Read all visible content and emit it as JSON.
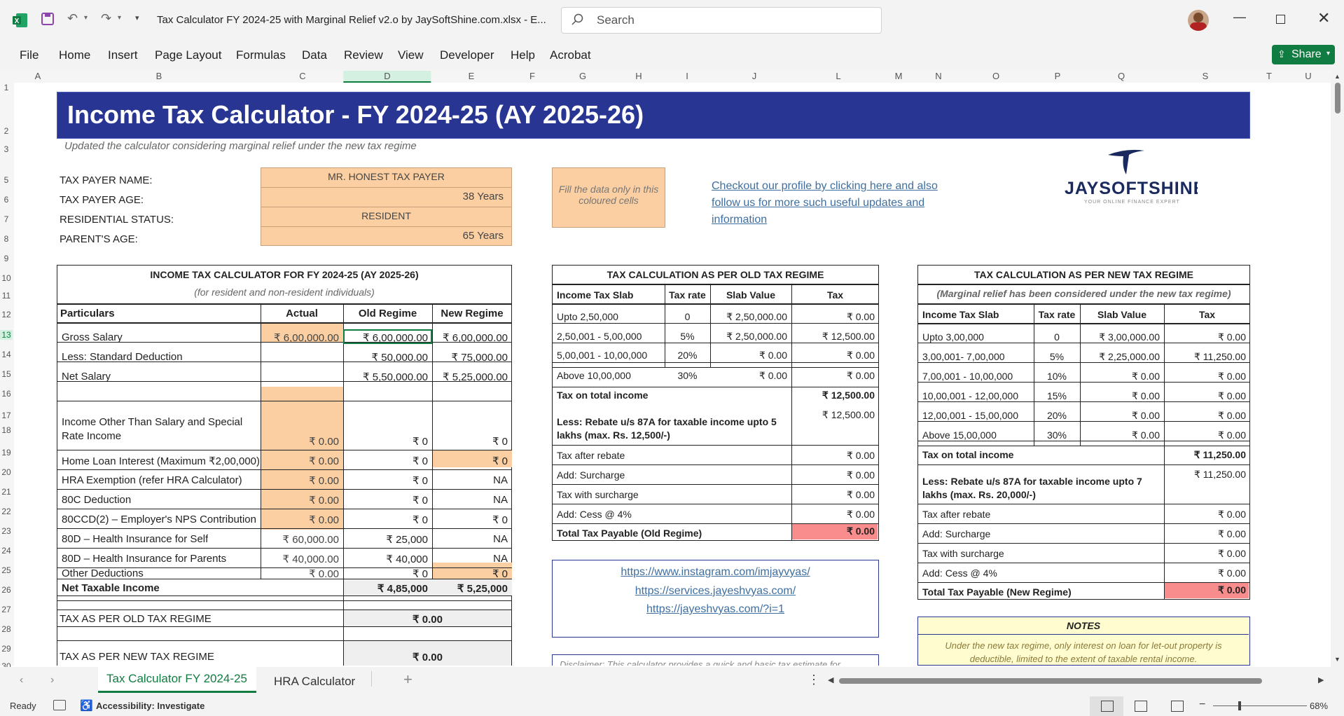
{
  "app": {
    "file_title": "Tax Calculator FY 2024-25 with Marginal Relief v2.o by JaySoftShine.com.xlsx  -  E...",
    "search_placeholder": "Search",
    "share_label": "Share"
  },
  "menu": [
    "File",
    "Home",
    "Insert",
    "Page Layout",
    "Formulas",
    "Data",
    "Review",
    "View",
    "Developer",
    "Help",
    "Acrobat"
  ],
  "columns": [
    "A",
    "B",
    "C",
    "D",
    "E",
    "F",
    "G",
    "H",
    "I",
    "J",
    "L",
    "M",
    "N",
    "O",
    "P",
    "Q",
    "S",
    "T",
    "U"
  ],
  "rows": [
    "1",
    "2",
    "3",
    "5",
    "6",
    "7",
    "8",
    "9",
    "10",
    "11",
    "12",
    "13",
    "14",
    "15",
    "16",
    "17",
    "18",
    "19",
    "20",
    "21",
    "22",
    "23",
    "24",
    "25",
    "26",
    "27",
    "28",
    "29",
    "30"
  ],
  "banner": {
    "title": "Income Tax Calculator - FY 2024-25 (AY 2025-26)",
    "subtitle": "Updated the calculator considering marginal relief under the new tax regime"
  },
  "taxpayer": {
    "name_label": "TAX PAYER NAME:",
    "name_value": "MR. HONEST TAX PAYER",
    "age_label": "TAX PAYER AGE:",
    "age_value": "38 Years",
    "status_label": "RESIDENTIAL STATUS:",
    "status_value": "RESIDENT",
    "parent_label": "PARENT'S AGE:",
    "parent_value": "65 Years"
  },
  "fill_note": "Fill the data only in this coloured cells",
  "profile_link": "Checkout our profile by clicking here and also follow us for more such useful updates and information",
  "logo": {
    "name": "JAYSOFTSHINE",
    "tagline": "YOUR ONLINE FINANCE EXPERT"
  },
  "main_table": {
    "title": "INCOME TAX CALCULATOR FOR FY 2024-25 (AY 2025-26)",
    "subtitle": "(for resident and non-resident individuals)",
    "headers": [
      "Particulars",
      "Actual",
      "Old Regime",
      "New Regime"
    ],
    "rows": [
      [
        "Gross Salary",
        "₹ 6,00,000.00",
        "₹ 6,00,000.00",
        "₹ 6,00,000.00"
      ],
      [
        "Less: Standard Deduction",
        "",
        "₹ 50,000.00",
        "₹ 75,000.00"
      ],
      [
        "Net Salary",
        "",
        "₹ 5,50,000.00",
        "₹ 5,25,000.00"
      ],
      [
        "",
        "",
        "",
        ""
      ],
      [
        "Income Other Than Salary and Special Rate Income",
        "₹ 0.00",
        "₹ 0",
        "₹ 0"
      ],
      [
        "Home Loan Interest (Maximum ₹2,00,000)",
        "₹ 0.00",
        "₹ 0",
        "₹ 0"
      ],
      [
        "HRA Exemption (refer HRA Calculator)",
        "₹ 0.00",
        "₹ 0",
        "NA"
      ],
      [
        "80C Deduction",
        "₹ 0.00",
        "₹ 0",
        "NA"
      ],
      [
        "80CCD(2) – Employer's NPS Contribution",
        "₹ 0.00",
        "₹ 0",
        "₹ 0"
      ],
      [
        "80D – Health Insurance for Self",
        "₹ 60,000.00",
        "₹ 25,000",
        "NA"
      ],
      [
        "80D – Health Insurance for Parents",
        "₹ 40,000.00",
        "₹ 40,000",
        "NA"
      ],
      [
        "Other Deductions",
        "₹ 0.00",
        "₹ 0",
        "₹ 0"
      ]
    ],
    "net_taxable_label": "Net Taxable Income",
    "net_taxable_old": "₹ 4,85,000",
    "net_taxable_new": "₹ 5,25,000",
    "old_label": "TAX AS PER OLD TAX REGIME",
    "old_value": "₹ 0.00",
    "new_label": "TAX AS PER NEW TAX REGIME",
    "new_value": "₹ 0.00"
  },
  "old_regime": {
    "title": "TAX CALCULATION AS PER OLD TAX REGIME",
    "headers": [
      "Income Tax Slab",
      "Tax rate",
      "Slab Value",
      "Tax"
    ],
    "slabs": [
      [
        "Upto 2,50,000",
        "0",
        "₹ 2,50,000.00",
        "₹ 0.00"
      ],
      [
        "2,50,001 - 5,00,000",
        "5%",
        "₹ 2,50,000.00",
        "₹ 12,500.00"
      ],
      [
        "5,00,001 - 10,00,000",
        "20%",
        "₹ 0.00",
        "₹ 0.00"
      ],
      [
        "Above 10,00,000",
        "30%",
        "₹ 0.00",
        "₹ 0.00"
      ]
    ],
    "total_label": "Tax on total income",
    "total_value": "₹ 12,500.00",
    "rebate_label": "Less: Rebate u/s 87A for taxable income upto 5 lakhs (max. Rs. 12,500/-)",
    "rebate_value": "₹ 12,500.00",
    "summary": [
      [
        "Tax after rebate",
        "₹ 0.00"
      ],
      [
        "Add: Surcharge",
        "₹ 0.00"
      ],
      [
        "Tax with surcharge",
        "₹ 0.00"
      ],
      [
        "Add: Cess @ 4%",
        "₹ 0.00"
      ]
    ],
    "payable_label": "Total Tax Payable (Old Regime)",
    "payable_value": "₹ 0.00"
  },
  "new_regime": {
    "title": "TAX CALCULATION AS PER NEW TAX REGIME",
    "subtitle": "(Marginal relief has been considered under the new tax regime)",
    "headers": [
      "Income Tax Slab",
      "Tax rate",
      "Slab Value",
      "Tax"
    ],
    "slabs": [
      [
        "Upto 3,00,000",
        "0",
        "₹ 3,00,000.00",
        "₹ 0.00"
      ],
      [
        "3,00,001- 7,00,000",
        "5%",
        "₹ 2,25,000.00",
        "₹ 11,250.00"
      ],
      [
        "7,00,001 - 10,00,000",
        "10%",
        "₹ 0.00",
        "₹ 0.00"
      ],
      [
        "10,00,001 - 12,00,000",
        "15%",
        "₹ 0.00",
        "₹ 0.00"
      ],
      [
        "12,00,001 - 15,00,000",
        "20%",
        "₹ 0.00",
        "₹ 0.00"
      ],
      [
        "Above 15,00,000",
        "30%",
        "₹ 0.00",
        "₹ 0.00"
      ]
    ],
    "total_label": "Tax on total income",
    "total_value": "₹ 11,250.00",
    "rebate_label": "Less: Rebate u/s 87A for taxable income upto 7 lakhs (max. Rs. 20,000/-)",
    "rebate_value": "₹ 11,250.00",
    "summary": [
      [
        "Tax after rebate",
        "₹ 0.00"
      ],
      [
        "Add: Surcharge",
        "₹ 0.00"
      ],
      [
        "Tax with surcharge",
        "₹ 0.00"
      ],
      [
        "Add: Cess @ 4%",
        "₹ 0.00"
      ]
    ],
    "payable_label": "Total Tax Payable (New Regime)",
    "payable_value": "₹ 0.00"
  },
  "links": [
    "https://www.instagram.com/imjayvyas/",
    "https://services.jayeshvyas.com/",
    "https://jayeshvyas.com/?i=1"
  ],
  "disclaimer": "Disclaimer: This calculator provides a quick and basic tax estimate for",
  "notes": {
    "title": "NOTES",
    "text": "Under the new tax regime, only interest on loan for let-out property is deductible, limited to the extent of taxable rental income."
  },
  "sheets": [
    "Tax Calculator FY 2024-25",
    "HRA Calculator"
  ],
  "status": {
    "ready": "Ready",
    "accessibility": "Accessibility: Investigate",
    "zoom": "68%"
  },
  "colors": {
    "banner": "#283593",
    "input": "#fbcfa2",
    "payable": "#f98d8d",
    "notes": "#fffccf",
    "excel_green": "#107c41"
  }
}
